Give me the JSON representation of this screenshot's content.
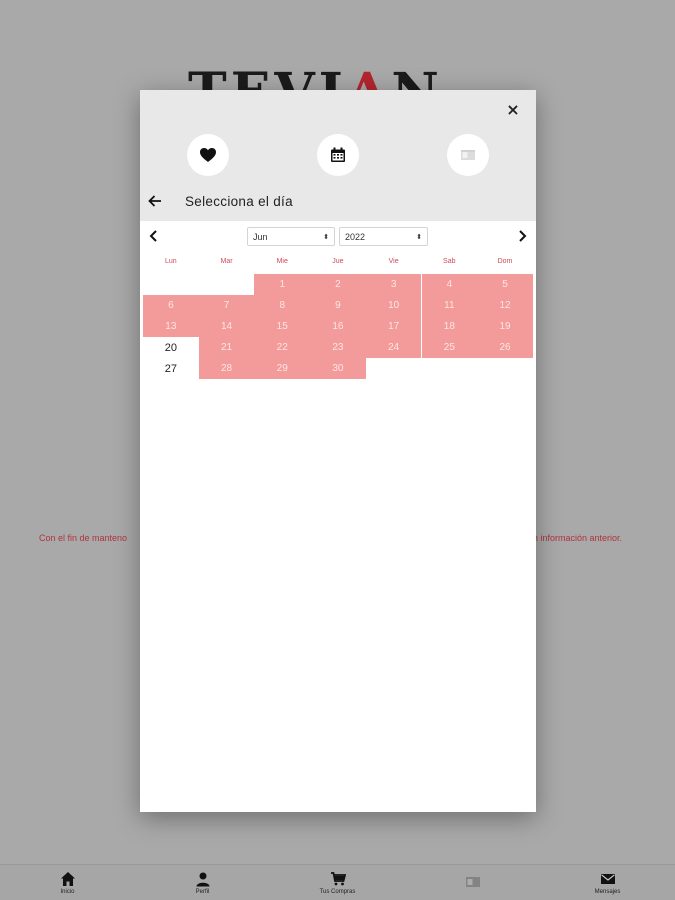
{
  "background": {
    "logo_text_start": "TEVI",
    "logo_text_accent": "A",
    "logo_text_end": "N",
    "notice_left": "Con el fin de manteno",
    "notice_right": "n información anterior."
  },
  "bottom_nav": {
    "items": [
      {
        "label": "Inicio",
        "icon": "home-icon"
      },
      {
        "label": "Perfil",
        "icon": "user-icon"
      },
      {
        "label": "Tus Compras",
        "icon": "cart-icon"
      },
      {
        "label": "",
        "icon": "ticket-icon"
      },
      {
        "label": "Mensajes",
        "icon": "mail-icon"
      }
    ]
  },
  "modal": {
    "close_label": "×",
    "steps": [
      {
        "icon": "heart-icon",
        "state": "done"
      },
      {
        "icon": "calendar-icon",
        "state": "active"
      },
      {
        "icon": "ticket-icon",
        "state": "pending"
      }
    ],
    "title": "Selecciona el día",
    "calendar": {
      "month": "Jun",
      "year": "2022",
      "weekdays": [
        "Lun",
        "Mar",
        "Mie",
        "Jue",
        "Vie",
        "Sab",
        "Dom"
      ],
      "weeks": [
        [
          "",
          "",
          "1",
          "2",
          "3",
          "4",
          "5"
        ],
        [
          "6",
          "7",
          "8",
          "9",
          "10",
          "11",
          "12"
        ],
        [
          "13",
          "14",
          "15",
          "16",
          "17",
          "18",
          "19"
        ],
        [
          "20",
          "21",
          "22",
          "23",
          "24",
          "25",
          "26"
        ],
        [
          "27",
          "28",
          "29",
          "30",
          "",
          "",
          ""
        ]
      ],
      "available_days": [
        "20",
        "27"
      ],
      "colors": {
        "unavailable": "#f39b9b",
        "weekday_label": "#d14a57"
      }
    }
  }
}
